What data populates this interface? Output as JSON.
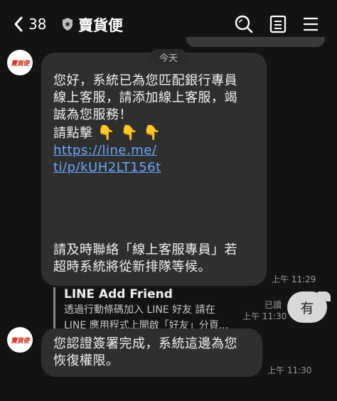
{
  "header": {
    "back_count": "38",
    "title": "賣貨便"
  },
  "chat": {
    "date_label": "今天",
    "sender_avatar_text": "賣貨便",
    "messages": [
      {
        "line1": "您好，系統已為您匹配銀行專員",
        "line2": "線上客服，請添加線上客服，竭",
        "line3": "誠為您服務！",
        "line4_prefix": "請點擊",
        "hands": "👇 👇 👇",
        "link_part1": "https://line.me/",
        "link_part2": "ti/p/kUH2LT156t",
        "para2_line1": "請及時聯絡「線上客服專員」若",
        "para2_line2": "超時系統將從新排隊等候。",
        "preview_title": "LINE Add Friend",
        "preview_desc1": "透過行動條碼加入 LINE 好友 請在",
        "preview_desc2": "LINE 應用程式上開啟「好友」分頁...",
        "time": "上午 11:29"
      },
      {
        "text": "有",
        "read_label": "已讀",
        "time": "上午 11:30"
      },
      {
        "line1": "您認證簽署完成，系統這邊為您",
        "line2": "恢復權限。",
        "time": "上午 11:30"
      }
    ]
  },
  "icons": [
    "back-chevron-icon",
    "shield-icon",
    "search-icon",
    "notes-icon",
    "menu-icon"
  ]
}
